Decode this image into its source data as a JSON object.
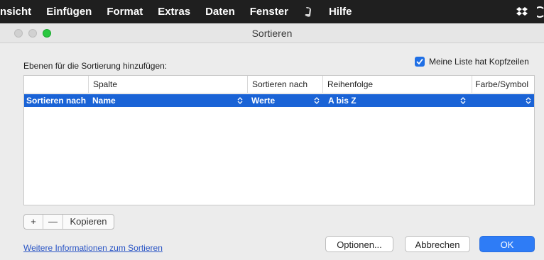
{
  "menubar": {
    "items": [
      "nsicht",
      "Einfügen",
      "Format",
      "Extras",
      "Daten",
      "Fenster",
      "Hilfe"
    ],
    "icons": [
      "script-icon",
      "dropbox-icon",
      "time-machine-icon"
    ]
  },
  "window": {
    "title": "Sortieren"
  },
  "dialog": {
    "subheading": "Ebenen für die Sortierung hinzufügen:",
    "header_checkbox": {
      "label": "Meine Liste hat Kopfzeilen",
      "checked": true
    },
    "table": {
      "columns": [
        "Spalte",
        "Sortieren nach",
        "Reihenfolge",
        "Farbe/Symbol"
      ],
      "rows": [
        {
          "row_label": "Sortieren nach",
          "column": "Name",
          "sort_on": "Werte",
          "order": "A bis Z",
          "color_icon": ""
        }
      ]
    },
    "controls": {
      "add": "+",
      "remove": "—",
      "copy": "Kopieren"
    },
    "help_link": "Weitere Informationen zum Sortieren",
    "buttons": {
      "options": "Optionen...",
      "cancel": "Abbrechen",
      "ok": "OK"
    }
  },
  "colors": {
    "selection": "#1a63d6",
    "primary_button": "#2e7cf6",
    "checkbox": "#1f6fe5"
  }
}
